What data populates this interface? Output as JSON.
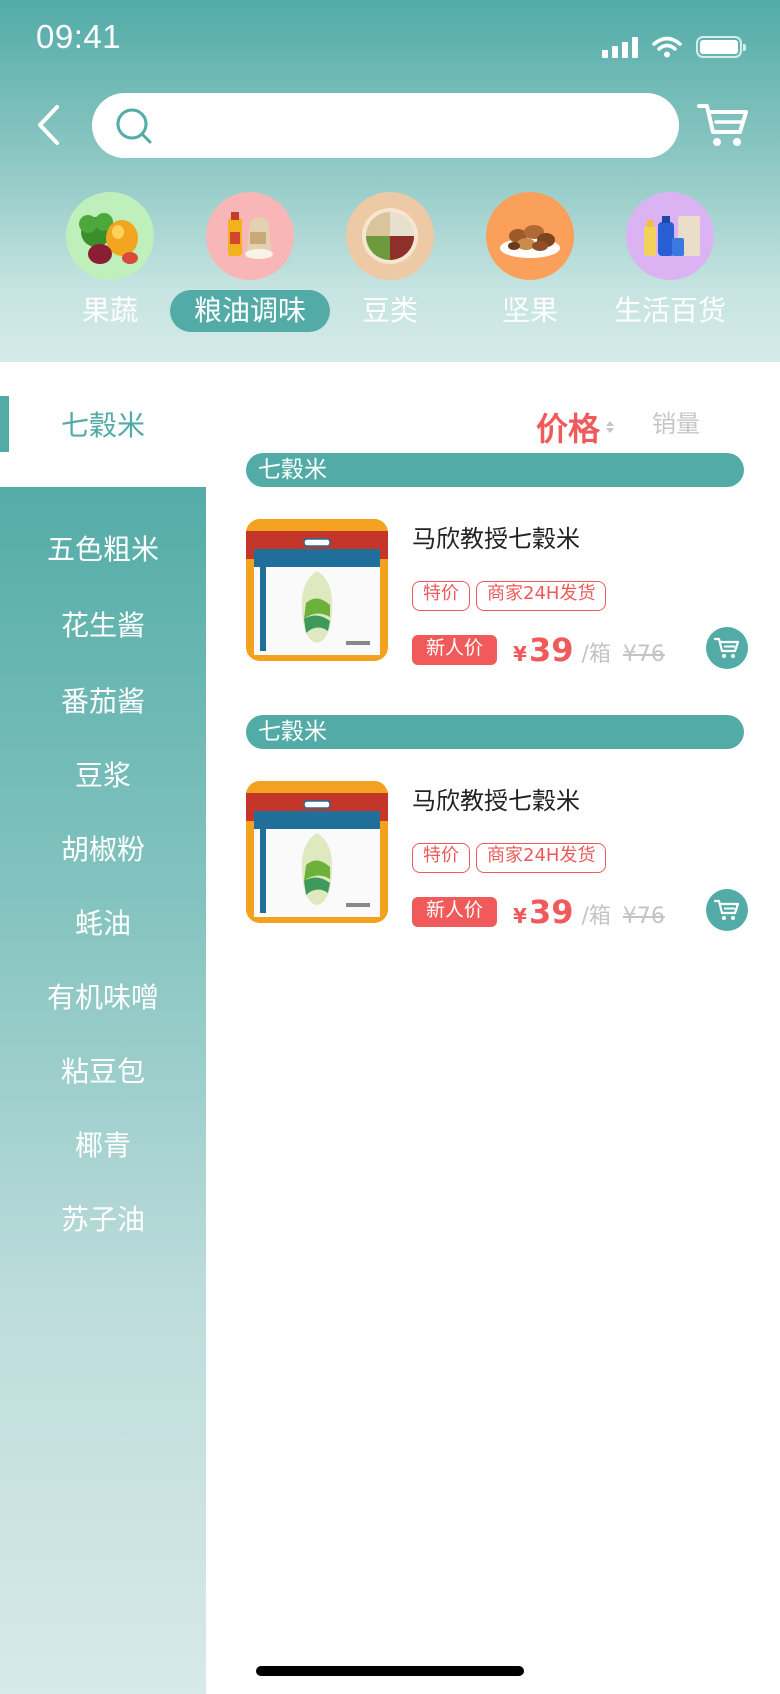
{
  "status": {
    "time": "09:41"
  },
  "search": {
    "placeholder": ""
  },
  "categories": [
    {
      "label": "果蔬",
      "icon": "fruit-vegetable-image",
      "active": false
    },
    {
      "label": "粮油调味",
      "icon": "grain-oil-image",
      "active": true
    },
    {
      "label": "豆类",
      "icon": "beans-image",
      "active": false
    },
    {
      "label": "坚果",
      "icon": "nuts-image",
      "active": false
    },
    {
      "label": "生活百货",
      "icon": "daily-goods-image",
      "active": false
    }
  ],
  "sidebar": {
    "active": "七穀米",
    "items": [
      "五色粗米",
      "花生酱",
      "番茄酱",
      "豆浆",
      "胡椒粉",
      "蚝油",
      "有机味噌",
      "粘豆包",
      "椰青",
      "苏子油"
    ]
  },
  "sort": {
    "price": "价格",
    "sales": "销量"
  },
  "groups": [
    {
      "title": "七穀米",
      "product": {
        "name": "马欣教授七穀米",
        "tags": [
          "特价",
          "商家24H发货"
        ],
        "badge": "新人价",
        "currency": "¥",
        "price": "39",
        "unit": "/箱",
        "old_price": "¥76"
      }
    },
    {
      "title": "七穀米",
      "product": {
        "name": "马欣教授七穀米",
        "tags": [
          "特价",
          "商家24H发货"
        ],
        "badge": "新人价",
        "currency": "¥",
        "price": "39",
        "unit": "/箱",
        "old_price": "¥76"
      }
    }
  ],
  "colors": {
    "accent": "#52aba7",
    "price": "#f05a5a",
    "muted": "#c4c4c4"
  }
}
